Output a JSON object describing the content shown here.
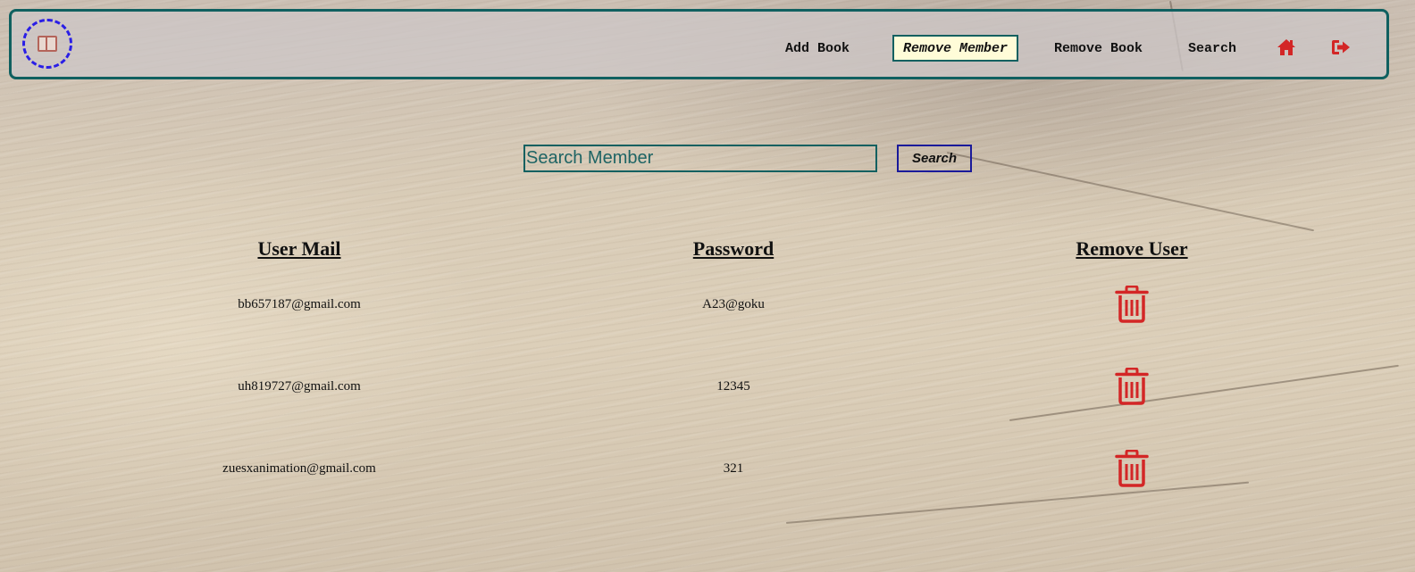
{
  "nav": {
    "links": [
      {
        "label": "Add Book"
      },
      {
        "label": "Remove Member"
      },
      {
        "label": "Remove Book"
      },
      {
        "label": "Search"
      }
    ],
    "icons": [
      "home-icon",
      "sign-out-icon"
    ],
    "border_color": "#106060",
    "active_bg": "#fffcd8",
    "icon_color": "#d32626"
  },
  "search": {
    "placeholder": "Search Member",
    "value": "",
    "button_label": "Search"
  },
  "table": {
    "headers": [
      "User Mail",
      "Password",
      "Remove User"
    ],
    "rows": [
      {
        "email": "bb657187@gmail.com",
        "password": "A23@goku",
        "action_icon": "trash-icon"
      },
      {
        "email": "uh819727@gmail.com",
        "password": "12345",
        "action_icon": "trash-icon"
      },
      {
        "email": "zuesxanimation@gmail.com",
        "password": "321",
        "action_icon": "trash-icon"
      }
    ]
  }
}
